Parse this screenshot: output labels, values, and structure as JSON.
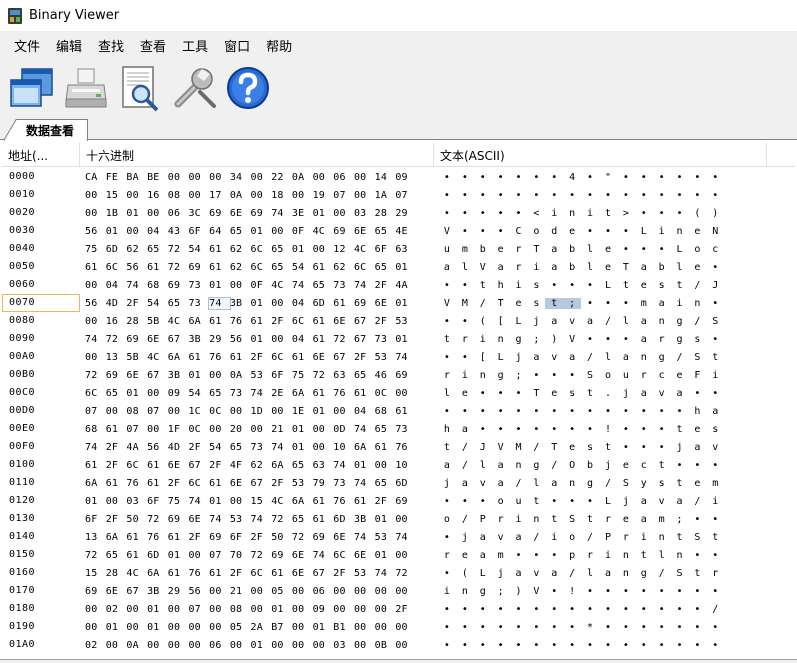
{
  "window": {
    "title": "Binary Viewer",
    "icon": "app-icon"
  },
  "menu": [
    "文件",
    "编辑",
    "查找",
    "查看",
    "工具",
    "窗口",
    "帮助"
  ],
  "toolbar": [
    {
      "icon": "windows-icon"
    },
    {
      "icon": "printer-icon"
    },
    {
      "icon": "print-preview-icon"
    },
    {
      "icon": "wrench-icon"
    },
    {
      "icon": "help-icon"
    }
  ],
  "tab": {
    "label": "数据查看"
  },
  "columns": {
    "address": "地址(...",
    "hex": "十六进制",
    "text": "文本(ASCII)"
  },
  "selection": {
    "row": 7,
    "hex_byte": 6,
    "text_chars": [
      6,
      7
    ]
  },
  "rows": [
    {
      "addr": "0000",
      "hex": [
        "CA",
        "FE",
        "BA",
        "BE",
        "00",
        "00",
        "00",
        "34",
        "00",
        "22",
        "0A",
        "00",
        "06",
        "00",
        "14",
        "09"
      ],
      "text": [
        "•",
        "•",
        "•",
        "•",
        "•",
        "•",
        "•",
        "4",
        "•",
        "\"",
        "•",
        "•",
        "•",
        "•",
        "•",
        "•"
      ]
    },
    {
      "addr": "0010",
      "hex": [
        "00",
        "15",
        "00",
        "16",
        "08",
        "00",
        "17",
        "0A",
        "00",
        "18",
        "00",
        "19",
        "07",
        "00",
        "1A",
        "07"
      ],
      "text": [
        "•",
        "•",
        "•",
        "•",
        "•",
        "•",
        "•",
        "•",
        "•",
        "•",
        "•",
        "•",
        "•",
        "•",
        "•",
        "•"
      ]
    },
    {
      "addr": "0020",
      "hex": [
        "00",
        "1B",
        "01",
        "00",
        "06",
        "3C",
        "69",
        "6E",
        "69",
        "74",
        "3E",
        "01",
        "00",
        "03",
        "28",
        "29"
      ],
      "text": [
        "•",
        "•",
        "•",
        "•",
        "•",
        "<",
        "i",
        "n",
        "i",
        "t",
        ">",
        "•",
        "•",
        "•",
        "(",
        ")"
      ]
    },
    {
      "addr": "0030",
      "hex": [
        "56",
        "01",
        "00",
        "04",
        "43",
        "6F",
        "64",
        "65",
        "01",
        "00",
        "0F",
        "4C",
        "69",
        "6E",
        "65",
        "4E"
      ],
      "text": [
        "V",
        "•",
        "•",
        "•",
        "C",
        "o",
        "d",
        "e",
        "•",
        "•",
        "•",
        "L",
        "i",
        "n",
        "e",
        "N"
      ]
    },
    {
      "addr": "0040",
      "hex": [
        "75",
        "6D",
        "62",
        "65",
        "72",
        "54",
        "61",
        "62",
        "6C",
        "65",
        "01",
        "00",
        "12",
        "4C",
        "6F",
        "63"
      ],
      "text": [
        "u",
        "m",
        "b",
        "e",
        "r",
        "T",
        "a",
        "b",
        "l",
        "e",
        "•",
        "•",
        "•",
        "L",
        "o",
        "c"
      ]
    },
    {
      "addr": "0050",
      "hex": [
        "61",
        "6C",
        "56",
        "61",
        "72",
        "69",
        "61",
        "62",
        "6C",
        "65",
        "54",
        "61",
        "62",
        "6C",
        "65",
        "01"
      ],
      "text": [
        "a",
        "l",
        "V",
        "a",
        "r",
        "i",
        "a",
        "b",
        "l",
        "e",
        "T",
        "a",
        "b",
        "l",
        "e",
        "•"
      ]
    },
    {
      "addr": "0060",
      "hex": [
        "00",
        "04",
        "74",
        "68",
        "69",
        "73",
        "01",
        "00",
        "0F",
        "4C",
        "74",
        "65",
        "73",
        "74",
        "2F",
        "4A"
      ],
      "text": [
        "•",
        "•",
        "t",
        "h",
        "i",
        "s",
        "•",
        "•",
        "•",
        "L",
        "t",
        "e",
        "s",
        "t",
        "/",
        "J"
      ]
    },
    {
      "addr": "0070",
      "hex": [
        "56",
        "4D",
        "2F",
        "54",
        "65",
        "73",
        "74",
        "3B",
        "01",
        "00",
        "04",
        "6D",
        "61",
        "69",
        "6E",
        "01"
      ],
      "text": [
        "V",
        "M",
        "/",
        "T",
        "e",
        "s",
        "t",
        ";",
        "•",
        "•",
        "•",
        "m",
        "a",
        "i",
        "n",
        "•"
      ]
    },
    {
      "addr": "0080",
      "hex": [
        "00",
        "16",
        "28",
        "5B",
        "4C",
        "6A",
        "61",
        "76",
        "61",
        "2F",
        "6C",
        "61",
        "6E",
        "67",
        "2F",
        "53"
      ],
      "text": [
        "•",
        "•",
        "(",
        "[",
        "L",
        "j",
        "a",
        "v",
        "a",
        "/",
        "l",
        "a",
        "n",
        "g",
        "/",
        "S"
      ]
    },
    {
      "addr": "0090",
      "hex": [
        "74",
        "72",
        "69",
        "6E",
        "67",
        "3B",
        "29",
        "56",
        "01",
        "00",
        "04",
        "61",
        "72",
        "67",
        "73",
        "01"
      ],
      "text": [
        "t",
        "r",
        "i",
        "n",
        "g",
        ";",
        ")",
        "V",
        "•",
        "•",
        "•",
        "a",
        "r",
        "g",
        "s",
        "•"
      ]
    },
    {
      "addr": "00A0",
      "hex": [
        "00",
        "13",
        "5B",
        "4C",
        "6A",
        "61",
        "76",
        "61",
        "2F",
        "6C",
        "61",
        "6E",
        "67",
        "2F",
        "53",
        "74"
      ],
      "text": [
        "•",
        "•",
        "[",
        "L",
        "j",
        "a",
        "v",
        "a",
        "/",
        "l",
        "a",
        "n",
        "g",
        "/",
        "S",
        "t"
      ]
    },
    {
      "addr": "00B0",
      "hex": [
        "72",
        "69",
        "6E",
        "67",
        "3B",
        "01",
        "00",
        "0A",
        "53",
        "6F",
        "75",
        "72",
        "63",
        "65",
        "46",
        "69"
      ],
      "text": [
        "r",
        "i",
        "n",
        "g",
        ";",
        "•",
        "•",
        "•",
        "S",
        "o",
        "u",
        "r",
        "c",
        "e",
        "F",
        "i"
      ]
    },
    {
      "addr": "00C0",
      "hex": [
        "6C",
        "65",
        "01",
        "00",
        "09",
        "54",
        "65",
        "73",
        "74",
        "2E",
        "6A",
        "61",
        "76",
        "61",
        "0C",
        "00"
      ],
      "text": [
        "l",
        "e",
        "•",
        "•",
        "•",
        "T",
        "e",
        "s",
        "t",
        ".",
        "j",
        "a",
        "v",
        "a",
        "•",
        "•"
      ]
    },
    {
      "addr": "00D0",
      "hex": [
        "07",
        "00",
        "08",
        "07",
        "00",
        "1C",
        "0C",
        "00",
        "1D",
        "00",
        "1E",
        "01",
        "00",
        "04",
        "68",
        "61"
      ],
      "text": [
        "•",
        "•",
        "•",
        "•",
        "•",
        "•",
        "•",
        "•",
        "•",
        "•",
        "•",
        "•",
        "•",
        "•",
        "h",
        "a"
      ]
    },
    {
      "addr": "00E0",
      "hex": [
        "68",
        "61",
        "07",
        "00",
        "1F",
        "0C",
        "00",
        "20",
        "00",
        "21",
        "01",
        "00",
        "0D",
        "74",
        "65",
        "73"
      ],
      "text": [
        "h",
        "a",
        "•",
        "•",
        "•",
        "•",
        "•",
        "•",
        "•",
        "!",
        "•",
        "•",
        "•",
        "t",
        "e",
        "s"
      ]
    },
    {
      "addr": "00F0",
      "hex": [
        "74",
        "2F",
        "4A",
        "56",
        "4D",
        "2F",
        "54",
        "65",
        "73",
        "74",
        "01",
        "00",
        "10",
        "6A",
        "61",
        "76"
      ],
      "text": [
        "t",
        "/",
        "J",
        "V",
        "M",
        "/",
        "T",
        "e",
        "s",
        "t",
        "•",
        "•",
        "•",
        "j",
        "a",
        "v"
      ]
    },
    {
      "addr": "0100",
      "hex": [
        "61",
        "2F",
        "6C",
        "61",
        "6E",
        "67",
        "2F",
        "4F",
        "62",
        "6A",
        "65",
        "63",
        "74",
        "01",
        "00",
        "10"
      ],
      "text": [
        "a",
        "/",
        "l",
        "a",
        "n",
        "g",
        "/",
        "O",
        "b",
        "j",
        "e",
        "c",
        "t",
        "•",
        "•",
        "•"
      ]
    },
    {
      "addr": "0110",
      "hex": [
        "6A",
        "61",
        "76",
        "61",
        "2F",
        "6C",
        "61",
        "6E",
        "67",
        "2F",
        "53",
        "79",
        "73",
        "74",
        "65",
        "6D"
      ],
      "text": [
        "j",
        "a",
        "v",
        "a",
        "/",
        "l",
        "a",
        "n",
        "g",
        "/",
        "S",
        "y",
        "s",
        "t",
        "e",
        "m"
      ]
    },
    {
      "addr": "0120",
      "hex": [
        "01",
        "00",
        "03",
        "6F",
        "75",
        "74",
        "01",
        "00",
        "15",
        "4C",
        "6A",
        "61",
        "76",
        "61",
        "2F",
        "69"
      ],
      "text": [
        "•",
        "•",
        "•",
        "o",
        "u",
        "t",
        "•",
        "•",
        "•",
        "L",
        "j",
        "a",
        "v",
        "a",
        "/",
        "i"
      ]
    },
    {
      "addr": "0130",
      "hex": [
        "6F",
        "2F",
        "50",
        "72",
        "69",
        "6E",
        "74",
        "53",
        "74",
        "72",
        "65",
        "61",
        "6D",
        "3B",
        "01",
        "00"
      ],
      "text": [
        "o",
        "/",
        "P",
        "r",
        "i",
        "n",
        "t",
        "S",
        "t",
        "r",
        "e",
        "a",
        "m",
        ";",
        "•",
        "•"
      ]
    },
    {
      "addr": "0140",
      "hex": [
        "13",
        "6A",
        "61",
        "76",
        "61",
        "2F",
        "69",
        "6F",
        "2F",
        "50",
        "72",
        "69",
        "6E",
        "74",
        "53",
        "74"
      ],
      "text": [
        "•",
        "j",
        "a",
        "v",
        "a",
        "/",
        "i",
        "o",
        "/",
        "P",
        "r",
        "i",
        "n",
        "t",
        "S",
        "t"
      ]
    },
    {
      "addr": "0150",
      "hex": [
        "72",
        "65",
        "61",
        "6D",
        "01",
        "00",
        "07",
        "70",
        "72",
        "69",
        "6E",
        "74",
        "6C",
        "6E",
        "01",
        "00"
      ],
      "text": [
        "r",
        "e",
        "a",
        "m",
        "•",
        "•",
        "•",
        "p",
        "r",
        "i",
        "n",
        "t",
        "l",
        "n",
        "•",
        "•"
      ]
    },
    {
      "addr": "0160",
      "hex": [
        "15",
        "28",
        "4C",
        "6A",
        "61",
        "76",
        "61",
        "2F",
        "6C",
        "61",
        "6E",
        "67",
        "2F",
        "53",
        "74",
        "72"
      ],
      "text": [
        "•",
        "(",
        "L",
        "j",
        "a",
        "v",
        "a",
        "/",
        "l",
        "a",
        "n",
        "g",
        "/",
        "S",
        "t",
        "r"
      ]
    },
    {
      "addr": "0170",
      "hex": [
        "69",
        "6E",
        "67",
        "3B",
        "29",
        "56",
        "00",
        "21",
        "00",
        "05",
        "00",
        "06",
        "00",
        "00",
        "00",
        "00"
      ],
      "text": [
        "i",
        "n",
        "g",
        ";",
        ")",
        "V",
        "•",
        "!",
        "•",
        "•",
        "•",
        "•",
        "•",
        "•",
        "•",
        "•"
      ]
    },
    {
      "addr": "0180",
      "hex": [
        "00",
        "02",
        "00",
        "01",
        "00",
        "07",
        "00",
        "08",
        "00",
        "01",
        "00",
        "09",
        "00",
        "00",
        "00",
        "2F"
      ],
      "text": [
        "•",
        "•",
        "•",
        "•",
        "•",
        "•",
        "•",
        "•",
        "•",
        "•",
        "•",
        "•",
        "•",
        "•",
        "•",
        "/"
      ]
    },
    {
      "addr": "0190",
      "hex": [
        "00",
        "01",
        "00",
        "01",
        "00",
        "00",
        "00",
        "05",
        "2A",
        "B7",
        "00",
        "01",
        "B1",
        "00",
        "00",
        "00"
      ],
      "text": [
        "•",
        "•",
        "•",
        "•",
        "•",
        "•",
        "•",
        "•",
        "*",
        "•",
        "•",
        "•",
        "•",
        "•",
        "•",
        "•"
      ]
    },
    {
      "addr": "01A0",
      "hex": [
        "02",
        "00",
        "0A",
        "00",
        "00",
        "00",
        "06",
        "00",
        "01",
        "00",
        "00",
        "00",
        "03",
        "00",
        "0B",
        "00"
      ],
      "text": [
        "•",
        "•",
        "•",
        "•",
        "•",
        "•",
        "•",
        "•",
        "•",
        "•",
        "•",
        "•",
        "•",
        "•",
        "•",
        "•"
      ]
    }
  ]
}
